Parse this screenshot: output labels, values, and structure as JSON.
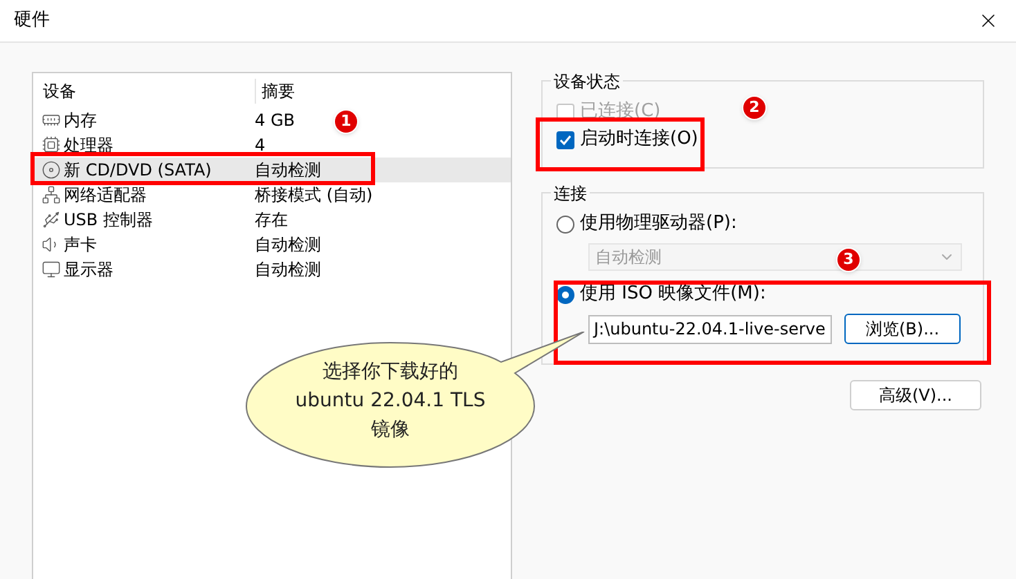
{
  "window": {
    "title": "硬件"
  },
  "device_list": {
    "columns": [
      "设备",
      "摘要"
    ],
    "rows": [
      {
        "kind": "memory",
        "device": "内存",
        "summary": "4 GB",
        "selected": false
      },
      {
        "kind": "cpu",
        "device": "处理器",
        "summary": "4",
        "selected": false
      },
      {
        "kind": "disc",
        "device": "新 CD/DVD (SATA)",
        "summary": "自动检测",
        "selected": true
      },
      {
        "kind": "network",
        "device": "网络适配器",
        "summary": "桥接模式 (自动)",
        "selected": false
      },
      {
        "kind": "usb",
        "device": "USB 控制器",
        "summary": "存在",
        "selected": false
      },
      {
        "kind": "sound",
        "device": "声卡",
        "summary": "自动检测",
        "selected": false
      },
      {
        "kind": "display",
        "device": "显示器",
        "summary": "自动检测",
        "selected": false
      }
    ]
  },
  "device_status": {
    "title": "设备状态",
    "options": [
      {
        "label": "已连接(C)",
        "checked": false,
        "disabled": true
      },
      {
        "label": "启动时连接(O)",
        "checked": true,
        "disabled": false
      }
    ]
  },
  "connection": {
    "title": "连接",
    "physical": {
      "label": "使用物理驱动器(P):",
      "selected": false,
      "drive": "自动检测"
    },
    "iso": {
      "label": "使用 ISO 映像文件(M):",
      "selected": true,
      "path": "J:\\ubuntu-22.04.1-live-serve",
      "browse": "浏览(B)..."
    }
  },
  "advanced_button": "高级(V)...",
  "annotations": {
    "markers": [
      "1",
      "2",
      "3"
    ],
    "callout": [
      "选择你下载好的",
      "ubuntu 22.04.1 TLS",
      "镜像"
    ]
  }
}
